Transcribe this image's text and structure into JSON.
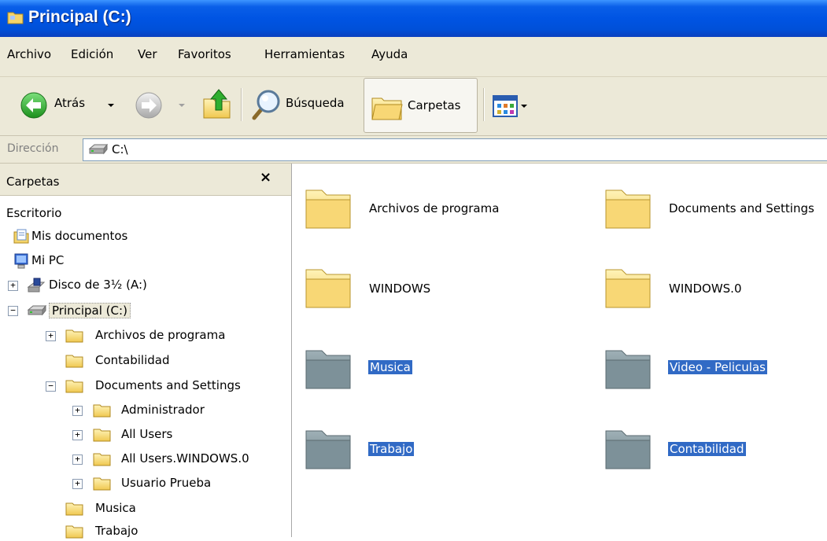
{
  "window": {
    "title": "Principal (C:)"
  },
  "menu": [
    "Archivo",
    "Edición",
    "Ver",
    "Favoritos",
    "Herramientas",
    "Ayuda"
  ],
  "toolbar": {
    "back": "Atrás",
    "search": "Búsqueda",
    "folders": "Carpetas"
  },
  "address": {
    "label": "Dirección",
    "value": "C:\\"
  },
  "folder_pane": {
    "title": "Carpetas",
    "close": "×",
    "tree": [
      {
        "label": "Escritorio",
        "icon": "desktop-icon"
      },
      {
        "label": "Mis documentos",
        "icon": "my-documents-icon"
      },
      {
        "label": "Mi PC",
        "icon": "my-computer-icon"
      },
      {
        "label": "Disco de 3½ (A:)",
        "icon": "floppy-icon",
        "expander": "+"
      },
      {
        "label": "Principal (C:)",
        "icon": "hard-drive-icon",
        "expander": "−",
        "selected": true
      },
      {
        "label": "Archivos de programa",
        "icon": "folder-icon",
        "expander": "+"
      },
      {
        "label": "Contabilidad",
        "icon": "folder-icon"
      },
      {
        "label": "Documents and Settings",
        "icon": "folder-icon",
        "expander": "−"
      },
      {
        "label": "Administrador",
        "icon": "folder-icon",
        "expander": "+"
      },
      {
        "label": "All Users",
        "icon": "folder-icon",
        "expander": "+"
      },
      {
        "label": "All Users.WINDOWS.0",
        "icon": "folder-icon",
        "expander": "+"
      },
      {
        "label": "Usuario Prueba",
        "icon": "folder-icon",
        "expander": "+"
      },
      {
        "label": "Musica",
        "icon": "folder-icon"
      },
      {
        "label": "Trabajo",
        "icon": "folder-icon"
      }
    ]
  },
  "content": {
    "items": [
      {
        "name": "Archivos de programa",
        "selected": false
      },
      {
        "name": "Documents and Settings",
        "selected": false
      },
      {
        "name": "WINDOWS",
        "selected": false
      },
      {
        "name": "WINDOWS.0",
        "selected": false
      },
      {
        "name": "Musica",
        "selected": true
      },
      {
        "name": "Video - Peliculas",
        "selected": true
      },
      {
        "name": "Trabajo",
        "selected": true
      },
      {
        "name": "Contabilidad",
        "selected": true
      }
    ]
  },
  "colors": {
    "titlebar": "#0054e3",
    "chrome": "#ece9d8",
    "selection": "#316ac5",
    "folder": "#f8d775",
    "folder_selected": "#7d9199"
  }
}
